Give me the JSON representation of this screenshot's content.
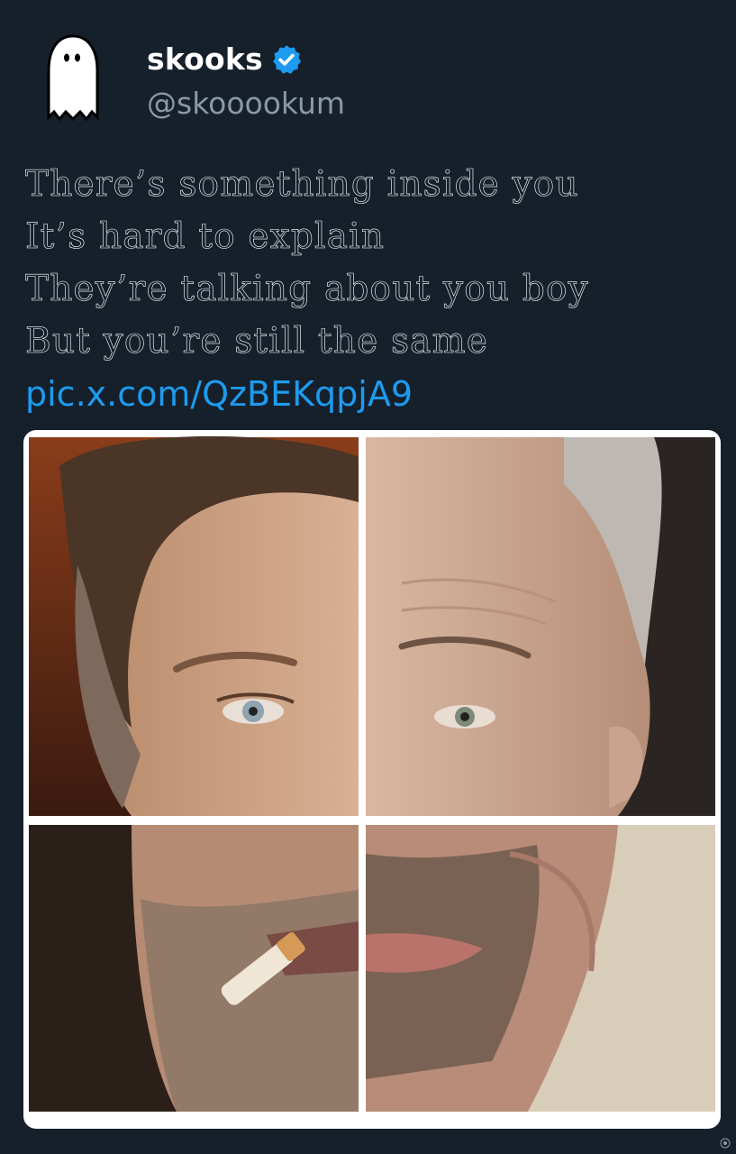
{
  "tweet": {
    "display_name": "skooks",
    "handle": "@skooookum",
    "verified": true,
    "avatar_icon": "ghost-icon",
    "lines": [
      "There’s something inside you",
      "It’s hard to explain",
      "They’re talking about you boy",
      "But you’re still the same"
    ],
    "link": "pic.x.com/QzBEKqpjA9",
    "media": {
      "layout": "2x2 photo collage",
      "description_icon": "face-collage-image"
    }
  },
  "colors": {
    "background": "#15202b",
    "link": "#1d9bf0",
    "handle": "#8b98a5",
    "verified_badge": "#1d9bf0"
  }
}
